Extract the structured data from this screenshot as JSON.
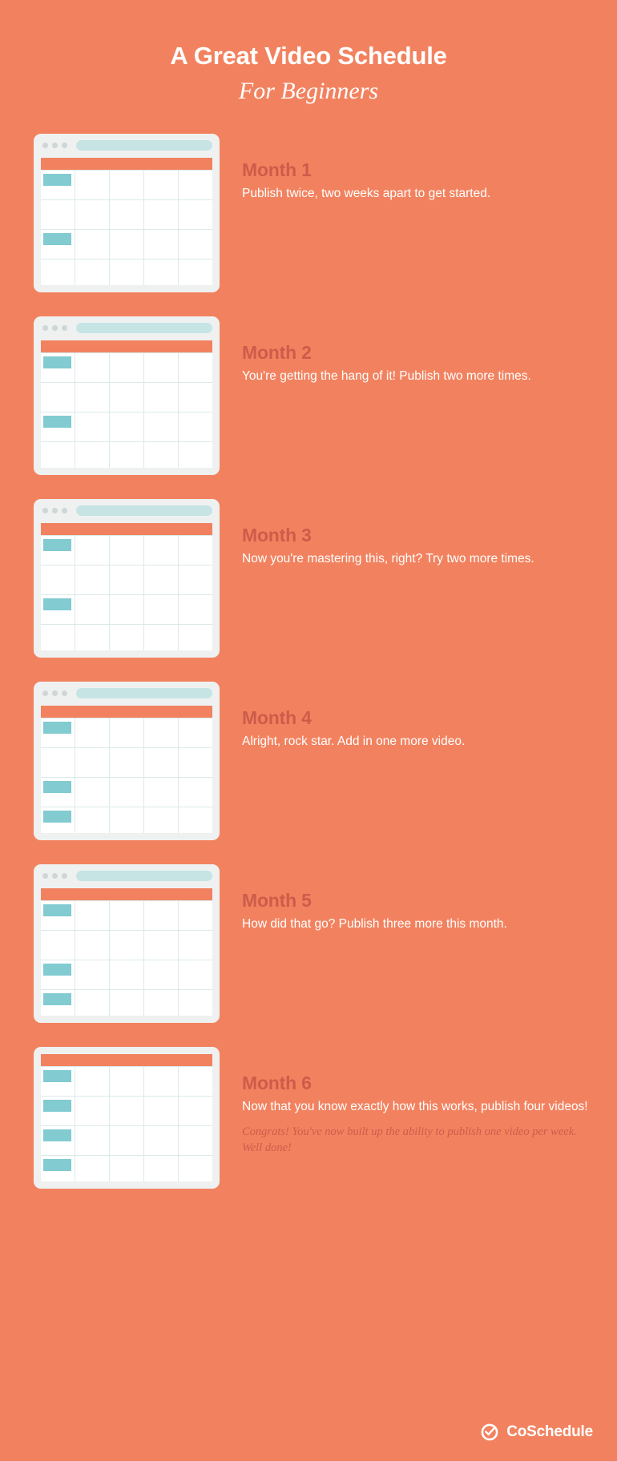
{
  "theme": {
    "background_color": "#F2825F",
    "card_frame_color": "#EFF1F1",
    "card_screen_color": "#FFFFFF",
    "header_strip_color": "#F2825F",
    "gridline_color": "#DCEAEA",
    "event_block_color": "#81CBD1",
    "address_bar_color": "#C6E4E4",
    "dot_color": "#CFD6D6",
    "heading_color": "#CC5C4A",
    "body_text_color": "#FFFFFF"
  },
  "header": {
    "title_main": "A Great Video Schedule",
    "title_sub": "For Beginners"
  },
  "months": [
    {
      "title": "Month 1",
      "body": "Publish twice, two weeks apart to get started.",
      "note": "",
      "has_chrome": true,
      "videos_published": 2,
      "grid_rows": 4,
      "grid_cols": 5,
      "events": [
        {
          "row": 1,
          "col": 1
        },
        {
          "row": 3,
          "col": 1
        }
      ]
    },
    {
      "title": "Month 2",
      "body": "You're getting the hang of it! Publish two more times.",
      "note": "",
      "has_chrome": true,
      "videos_published": 2,
      "grid_rows": 4,
      "grid_cols": 5,
      "events": [
        {
          "row": 1,
          "col": 1
        },
        {
          "row": 3,
          "col": 1
        }
      ]
    },
    {
      "title": "Month 3",
      "body": "Now you're mastering this, right? Try two more times.",
      "note": "",
      "has_chrome": true,
      "videos_published": 2,
      "grid_rows": 4,
      "grid_cols": 5,
      "events": [
        {
          "row": 1,
          "col": 1
        },
        {
          "row": 3,
          "col": 1
        }
      ]
    },
    {
      "title": "Month 4",
      "body": "Alright, rock star. Add in one more video.",
      "note": "",
      "has_chrome": true,
      "videos_published": 3,
      "grid_rows": 4,
      "grid_cols": 5,
      "events": [
        {
          "row": 1,
          "col": 1
        },
        {
          "row": 3,
          "col": 1
        },
        {
          "row": 4,
          "col": 1
        }
      ]
    },
    {
      "title": "Month 5",
      "body": "How did that go? Publish three more this month.",
      "note": "",
      "has_chrome": true,
      "videos_published": 3,
      "grid_rows": 4,
      "grid_cols": 5,
      "events": [
        {
          "row": 1,
          "col": 1
        },
        {
          "row": 3,
          "col": 1
        },
        {
          "row": 4,
          "col": 1
        }
      ]
    },
    {
      "title": "Month 6",
      "body": "Now that you know exactly how this works, publish four videos!",
      "note": "Congrats! You've now built up the ability to publish one video per week. Well done!",
      "has_chrome": false,
      "videos_published": 4,
      "grid_rows": 4,
      "grid_cols": 5,
      "events": [
        {
          "row": 1,
          "col": 1
        },
        {
          "row": 2,
          "col": 1
        },
        {
          "row": 3,
          "col": 1
        },
        {
          "row": 4,
          "col": 1
        }
      ]
    }
  ],
  "footer": {
    "brand_name": "CoSchedule",
    "logo_icon": "check-circle-icon"
  }
}
